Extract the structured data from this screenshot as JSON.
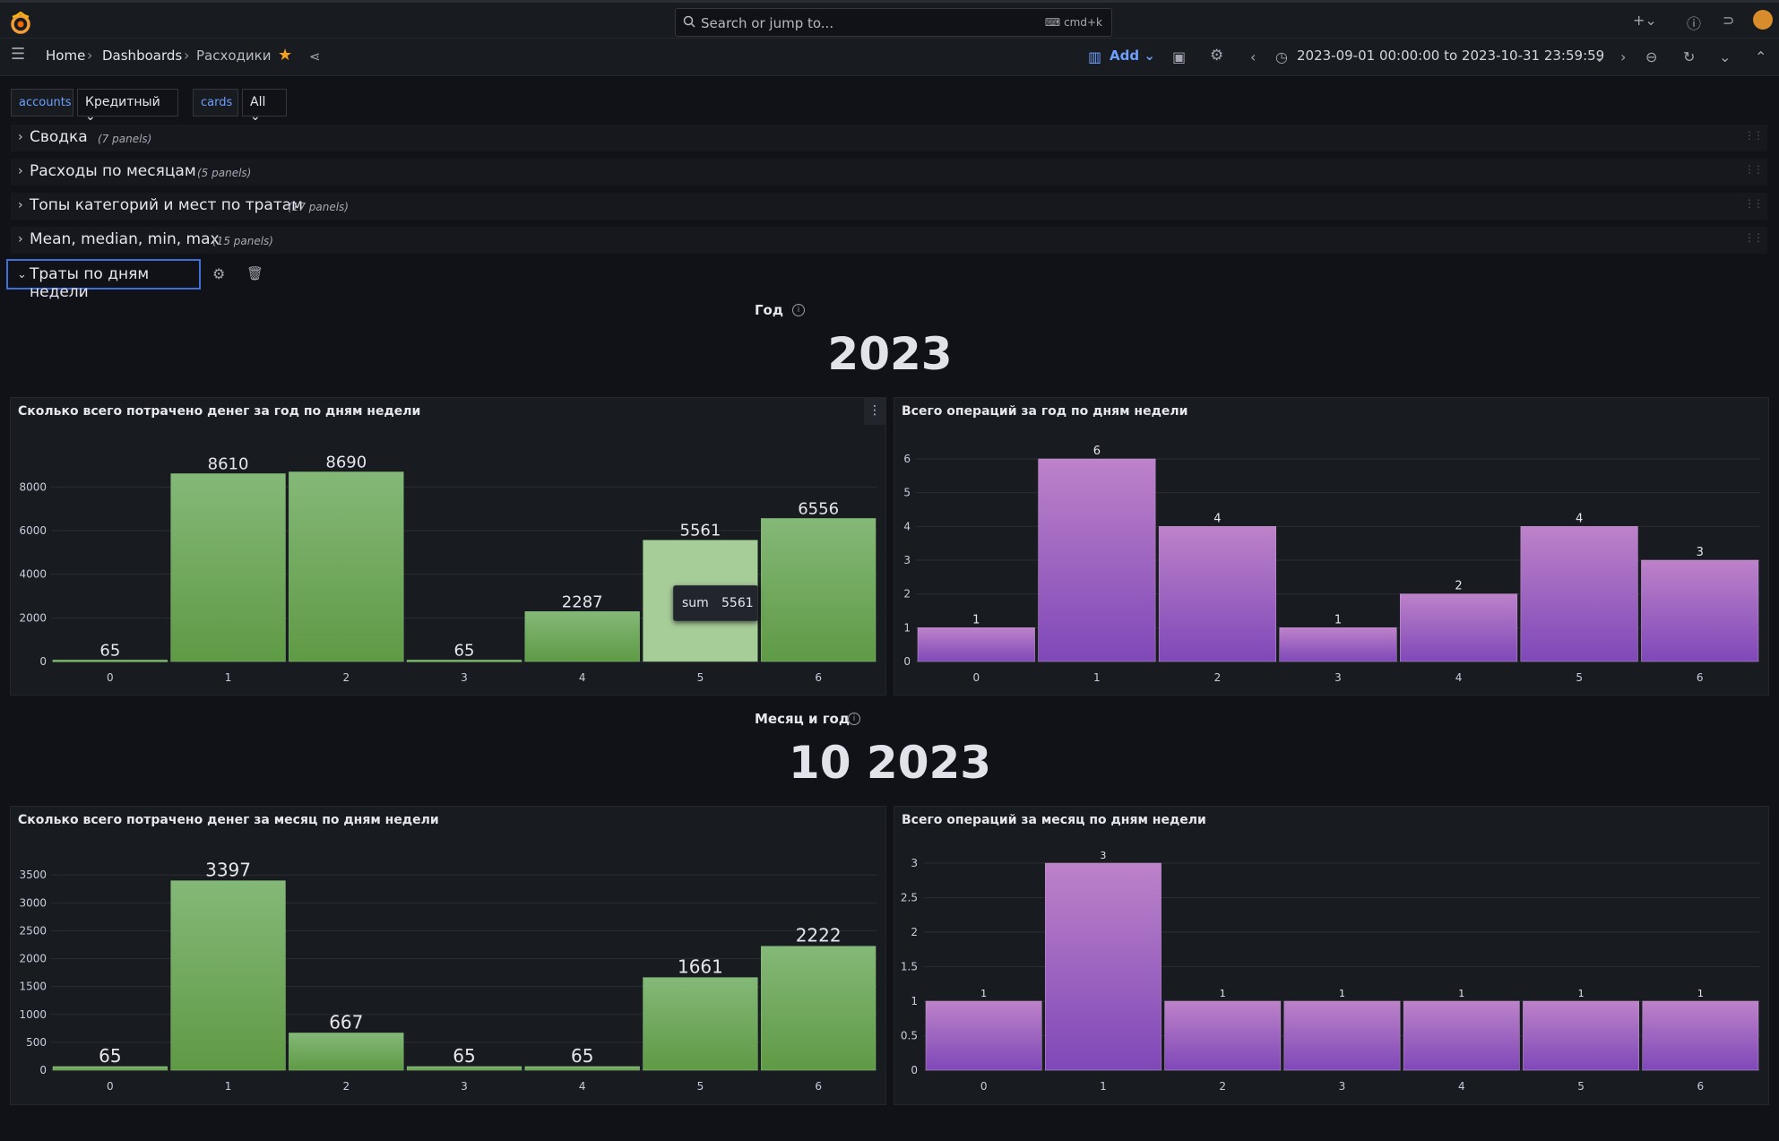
{
  "topbar": {
    "search_placeholder": "Search or jump to...",
    "search_shortcut": "cmd+k"
  },
  "breadcrumbs": {
    "home": "Home",
    "dashboards": "Dashboards",
    "current": "Расходики"
  },
  "toolbar": {
    "add_label": "Add",
    "time_range": "2023-09-01 00:00:00 to 2023-10-31 23:59:59"
  },
  "variables": [
    {
      "label": "accounts",
      "value": "Кредитный"
    },
    {
      "label": "cards",
      "value": "All"
    }
  ],
  "rows": [
    {
      "title": "Сводка",
      "count": "(7 panels)"
    },
    {
      "title": "Расходы по месяцам",
      "count": "(5 panels)"
    },
    {
      "title": "Топы категорий и мест по тратам",
      "count": "(17 panels)"
    },
    {
      "title": "Mean, median, min, max",
      "count": "(15 panels)"
    }
  ],
  "open_row": {
    "title": "Траты по дням недели"
  },
  "stat_year": {
    "title": "Год",
    "value": "2023"
  },
  "stat_month": {
    "title": "Месяц и год",
    "value": "10 2023"
  },
  "tooltip": {
    "key": "sum",
    "value": "5561"
  },
  "colors": {
    "green": "#73bf69",
    "purple": "#a352cc",
    "accent": "#6e9fff"
  },
  "chart_data": [
    {
      "type": "bar",
      "title": "Сколько всего потрачено денег за год по дням недели",
      "categories": [
        "0",
        "1",
        "2",
        "3",
        "4",
        "5",
        "6"
      ],
      "values": [
        65,
        8610,
        8690,
        65,
        2287,
        5561,
        6556
      ],
      "ylim": [
        0,
        9000
      ],
      "yticks": [
        0,
        2000,
        4000,
        6000,
        8000
      ],
      "highlight_index": 5,
      "color": "green"
    },
    {
      "type": "bar",
      "title": "Всего операций за год по дням недели",
      "categories": [
        "0",
        "1",
        "2",
        "3",
        "4",
        "5",
        "6"
      ],
      "values": [
        1,
        6,
        4,
        1,
        2,
        4,
        3
      ],
      "ylim": [
        0,
        6
      ],
      "yticks": [
        0,
        1,
        2,
        3,
        4,
        5,
        6
      ],
      "color": "purple"
    },
    {
      "type": "bar",
      "title": "Сколько всего потрачено денег за месяц по дням недели",
      "categories": [
        "0",
        "1",
        "2",
        "3",
        "4",
        "5",
        "6"
      ],
      "values": [
        65,
        3397,
        667,
        65,
        65,
        1661,
        2222
      ],
      "ylim": [
        0,
        3600
      ],
      "yticks": [
        0,
        500,
        1000,
        1500,
        2000,
        2500,
        3000,
        3500
      ],
      "color": "green"
    },
    {
      "type": "bar",
      "title": "Всего операций за месяц по дням недели",
      "categories": [
        "0",
        "1",
        "2",
        "3",
        "4",
        "5",
        "6"
      ],
      "values": [
        1,
        3,
        1,
        1,
        1,
        1,
        1
      ],
      "ylim": [
        0,
        3
      ],
      "yticks": [
        0,
        0.5,
        1,
        1.5,
        2,
        2.5,
        3
      ],
      "color": "purple"
    }
  ]
}
